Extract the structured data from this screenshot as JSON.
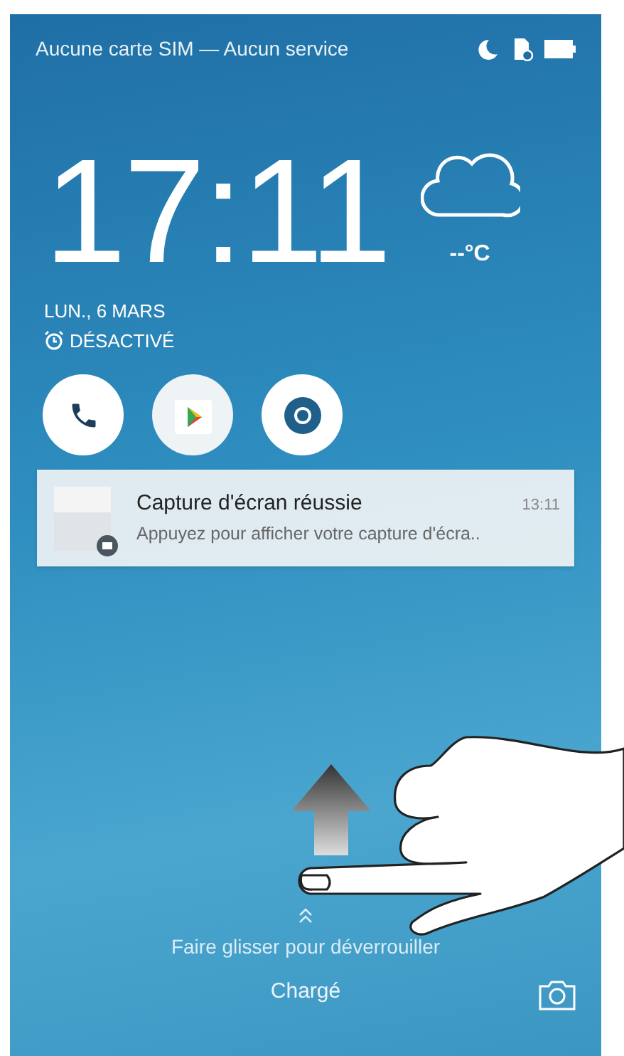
{
  "status_bar": {
    "carrier_text": "Aucune carte SIM — Aucun service"
  },
  "clock": {
    "time": "17:11",
    "date": "LUN., 6 MARS",
    "alarm": "DÉSACTIVÉ"
  },
  "weather": {
    "temperature": "--°C"
  },
  "notification": {
    "title": "Capture d'écran réussie",
    "time": "13:11",
    "text": "Appuyez pour afficher votre capture d'écra.."
  },
  "unlock_hint": "Faire glisser pour déverrouiller",
  "charge_status": "Chargé"
}
